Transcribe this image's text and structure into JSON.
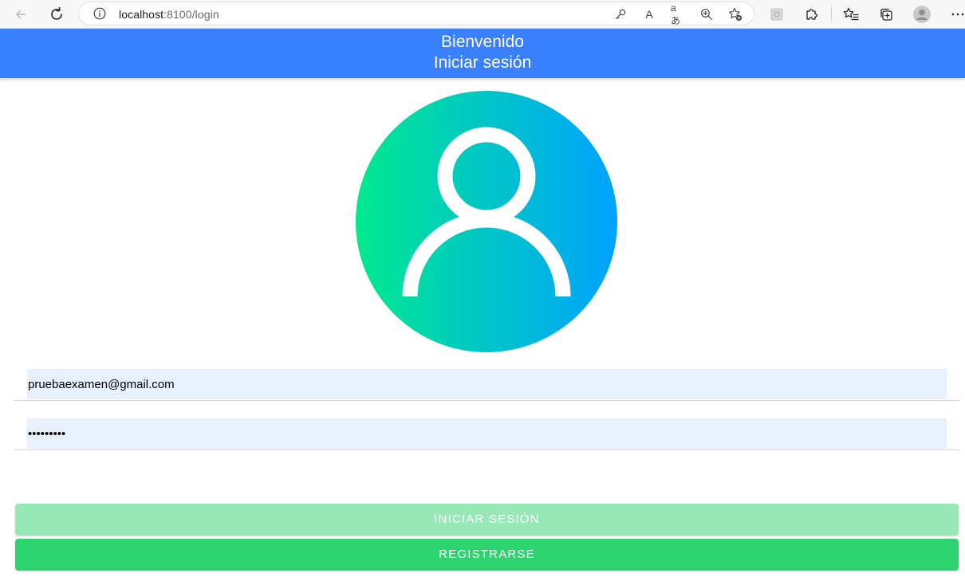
{
  "browser": {
    "url_host": "localhost",
    "url_port_path": ":8100/login",
    "icons": {
      "back": "back-arrow-icon",
      "reload": "reload-icon",
      "info": "info-icon",
      "key": "key-icon",
      "read_aloud": "read-aloud-icon",
      "translate": "translate-icon",
      "zoom": "zoom-icon",
      "favorite_add": "favorite-add-icon",
      "extension_tile": "extension-tile-icon",
      "extensions": "puzzle-icon",
      "favorites": "favorites-icon",
      "collections": "collections-icon",
      "profile": "profile-avatar-icon",
      "more": "more-menu-icon"
    },
    "read_aloud_glyph": "A",
    "translate_glyph": "aあ"
  },
  "header": {
    "title": "Bienvenido",
    "subtitle": "Iniciar sesión",
    "background_color": "#3880ff"
  },
  "avatar": {
    "icon": "user-avatar-icon",
    "gradient_start": "#00e98e",
    "gradient_end": "#00a2ff"
  },
  "form": {
    "email_value": "pruebaexamen@gmail.com",
    "password_value": "*********",
    "autofill_color": "#e8f0fe"
  },
  "buttons": {
    "login_label": "INICIAR SESIÓN",
    "register_label": "REGISTRARSE",
    "login_color": "#98e8b6",
    "register_color": "#2dd36f"
  }
}
